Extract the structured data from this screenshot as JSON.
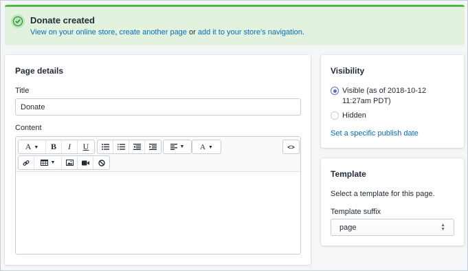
{
  "banner": {
    "title": "Donate created",
    "link_store": "View on your online store",
    "sep1": ", ",
    "link_another": "create another page",
    "sep2": " or ",
    "link_nav": "add it to your store’s navigation",
    "end": "."
  },
  "page_details": {
    "title": "Page details",
    "title_label": "Title",
    "title_value": "Donate",
    "content_label": "Content"
  },
  "toolbar": {
    "font_label": "A",
    "bold_label": "B",
    "italic_label": "I",
    "underline_label": "U",
    "text_color_label": "A",
    "html_label": "<>"
  },
  "visibility": {
    "title": "Visibility",
    "visible_label": "Visible (as of 2018-10-12 11:27am PDT)",
    "hidden_label": "Hidden",
    "publish_link": "Set a specific publish date"
  },
  "template": {
    "title": "Template",
    "description": "Select a template for this page.",
    "suffix_label": "Template suffix",
    "suffix_value": "page"
  },
  "colors": {
    "banner_bg": "#e3f1df",
    "banner_border": "#50b83c",
    "link": "#006fbb",
    "radio_accent": "#5c6ac4"
  }
}
